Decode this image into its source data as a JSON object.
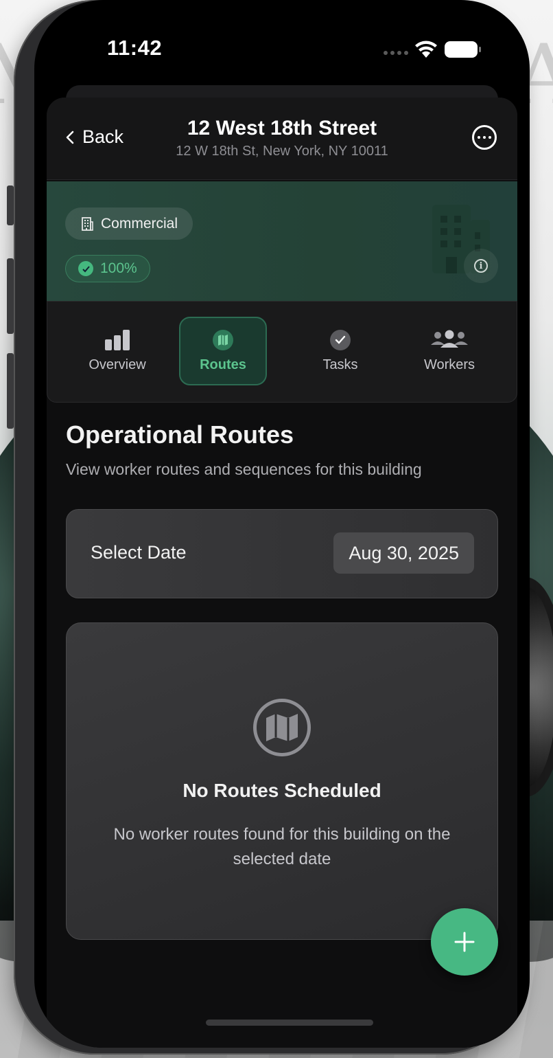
{
  "status_bar": {
    "time": "11:42"
  },
  "header": {
    "back_label": "Back",
    "title": "12 West 18th Street",
    "subtitle": "12 W 18th St, New York, NY 10011"
  },
  "building": {
    "type_label": "Commercial",
    "completion": "100%",
    "icons": {
      "type": "building-icon",
      "completion": "check-circle-icon",
      "info": "info-icon"
    }
  },
  "tabs": [
    {
      "label": "Overview",
      "icon": "bar-chart-icon",
      "active": false
    },
    {
      "label": "Routes",
      "icon": "map-icon",
      "active": true
    },
    {
      "label": "Tasks",
      "icon": "checkmark-icon",
      "active": false
    },
    {
      "label": "Workers",
      "icon": "people-icon",
      "active": false
    }
  ],
  "routes": {
    "title": "Operational Routes",
    "description": "View worker routes and sequences for this building",
    "date_label": "Select Date",
    "date_value": "Aug 30, 2025",
    "empty_title": "No Routes Scheduled",
    "empty_message": "No worker routes found for this building on the selected date"
  },
  "colors": {
    "accent": "#47b883",
    "accent_text": "#5cc48e",
    "hero_bg": "#27483d",
    "screen_bg": "#000000",
    "card_bg": "#3a3a3c"
  }
}
